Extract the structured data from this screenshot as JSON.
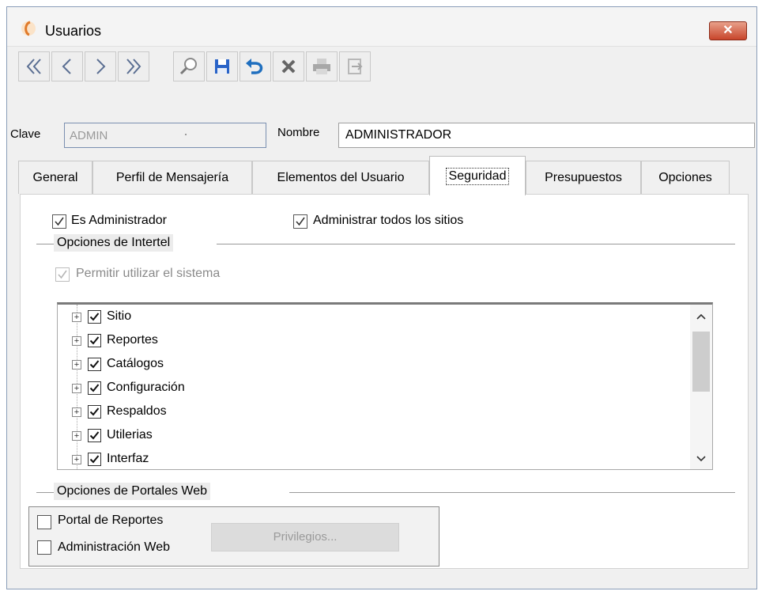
{
  "window": {
    "title": "Usuarios",
    "close_symbol": "✕"
  },
  "toolbar": {
    "buttons": [
      {
        "name": "first-record",
        "icon": "double-chevron-left-icon"
      },
      {
        "name": "previous-record",
        "icon": "chevron-left-icon"
      },
      {
        "name": "next-record",
        "icon": "chevron-right-icon"
      },
      {
        "name": "last-record",
        "icon": "double-chevron-right-icon"
      },
      {
        "name": "search",
        "icon": "magnifier-icon"
      },
      {
        "name": "save",
        "icon": "floppy-disk-icon"
      },
      {
        "name": "undo",
        "icon": "undo-arrow-icon"
      },
      {
        "name": "delete",
        "icon": "x-icon"
      },
      {
        "name": "print",
        "icon": "printer-icon"
      },
      {
        "name": "exit",
        "icon": "exit-arrow-icon"
      }
    ]
  },
  "form": {
    "clave_label": "Clave",
    "clave_value": "ADMIN",
    "nombre_label": "Nombre",
    "nombre_value": "ADMINISTRADOR"
  },
  "tabs": [
    {
      "label": "General",
      "active": false
    },
    {
      "label": "Perfil de Mensajería",
      "active": false
    },
    {
      "label": "Elementos del Usuario",
      "active": false
    },
    {
      "label": "Seguridad",
      "active": true
    },
    {
      "label": "Presupuestos",
      "active": false
    },
    {
      "label": "Opciones",
      "active": false
    }
  ],
  "security": {
    "es_admin_label": "Es Administrador",
    "es_admin_checked": true,
    "admin_sitios_label": "Administrar todos los sitios",
    "admin_sitios_checked": true,
    "intertel_group": "Opciones de Intertel",
    "permitir_label": "Permitir utilizar el sistema",
    "permitir_checked": true,
    "permitir_enabled": false,
    "tree": [
      {
        "label": "Sitio",
        "checked": true
      },
      {
        "label": "Reportes",
        "checked": true
      },
      {
        "label": "Catálogos",
        "checked": true
      },
      {
        "label": "Configuración",
        "checked": true
      },
      {
        "label": "Respaldos",
        "checked": true
      },
      {
        "label": "Utilerias",
        "checked": true
      },
      {
        "label": "Interfaz",
        "checked": true
      }
    ],
    "scroll_up": "^",
    "scroll_down": "v",
    "web_group": "Opciones de Portales Web",
    "portal_reportes_label": "Portal de Reportes",
    "portal_reportes_checked": false,
    "admin_web_label": "Administración Web",
    "admin_web_checked": false,
    "privilegios_label": "Privilegios..."
  }
}
